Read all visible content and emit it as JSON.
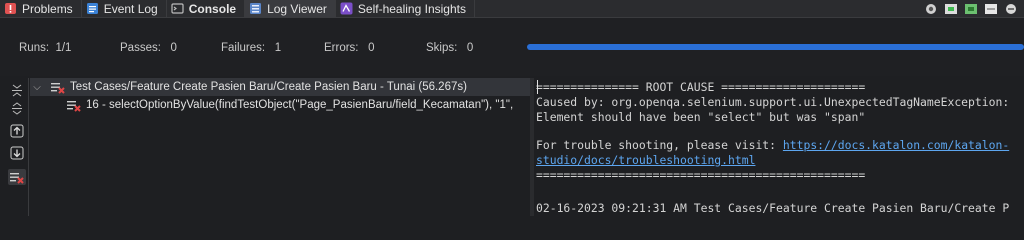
{
  "tabs": [
    {
      "label": "Problems",
      "icon": "problems-icon"
    },
    {
      "label": "Event Log",
      "icon": "event-log-icon"
    },
    {
      "label": "Console",
      "icon": "console-icon"
    },
    {
      "label": "Log Viewer",
      "icon": "log-viewer-icon"
    },
    {
      "label": "Self-healing Insights",
      "icon": "self-healing-icon"
    }
  ],
  "summary": {
    "runs_label": "Runs:",
    "runs_value": "1/1",
    "passes_label": "Passes:",
    "passes_value": "0",
    "failures_label": "Failures:",
    "failures_value": "1",
    "errors_label": "Errors:",
    "errors_value": "0",
    "skips_label": "Skips:",
    "skips_value": "0",
    "progress": 1.0,
    "progress_color": "#2a6fd6"
  },
  "tree": {
    "root_label": "Test Cases/Feature Create Pasien Baru/Create Pasien Baru - Tunai (56.267s)",
    "child_label": "16 - selectOptionByValue(findTestObject(\"Page_PasienBaru/field_Kecamatan\"), \"1\","
  },
  "log": {
    "line1": "=============== ROOT CAUSE =====================",
    "line2": "Caused by: org.openqa.selenium.support.ui.UnexpectedTagNameException:",
    "line3": "Element should have been \"select\" but was \"span\"",
    "line4_prefix": "For trouble shooting, please visit: ",
    "line4_link": "https://docs.katalon.com/katalon-",
    "line5_link": "studio/docs/troubleshooting.html",
    "line6": "================================================",
    "line7": "02-16-2023 09:21:31 AM Test Cases/Feature Create Pasien Baru/Create P"
  }
}
